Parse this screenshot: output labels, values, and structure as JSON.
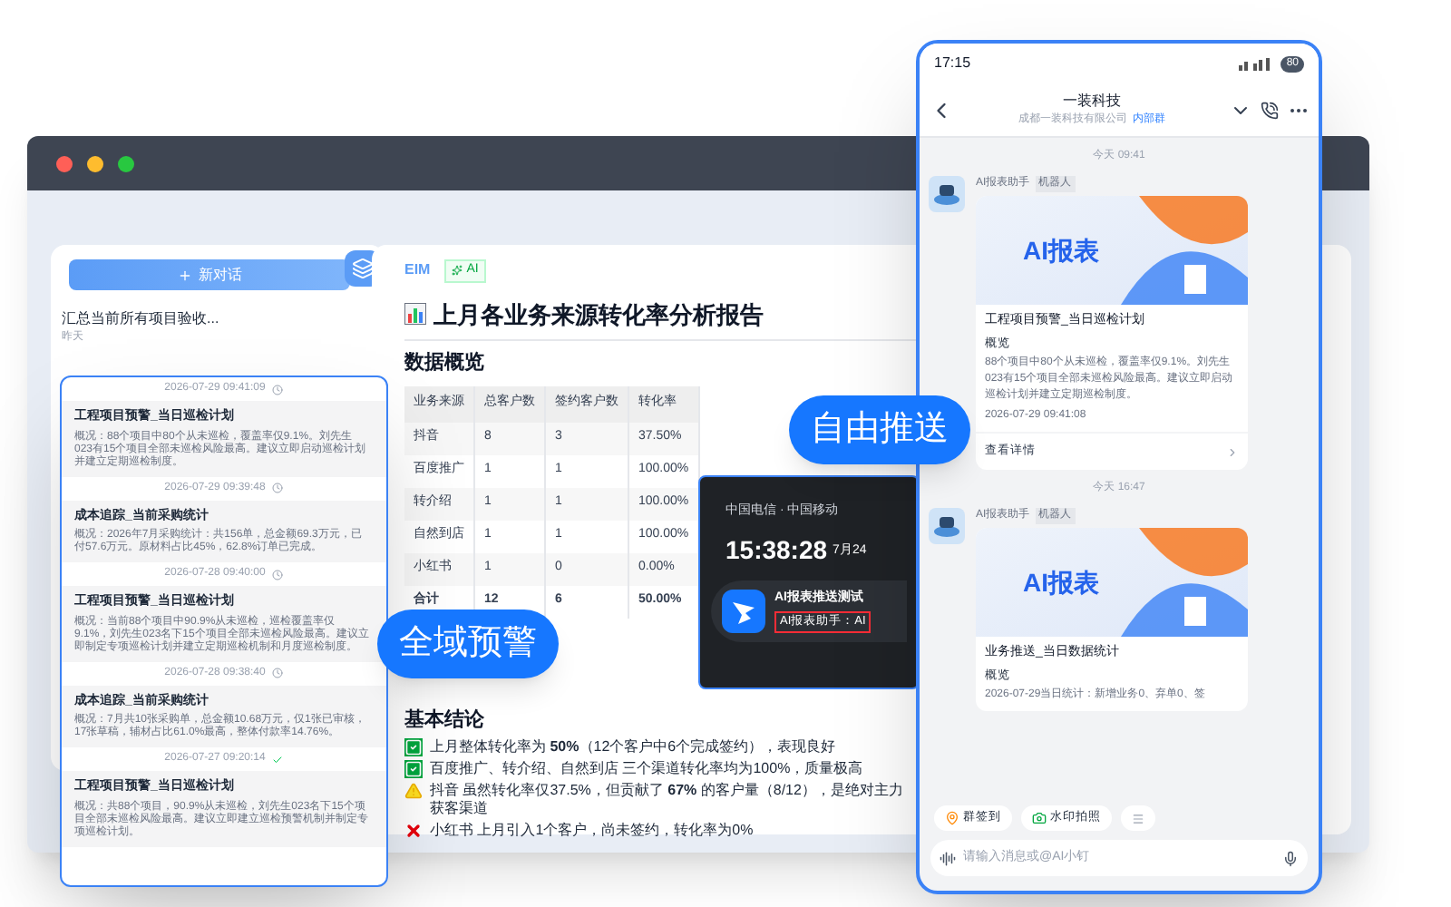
{
  "browser": {
    "sidebar": {
      "new_chat_button": "新对话",
      "history": [
        {
          "title": "汇总当前所有项目验收...",
          "time": "昨天"
        }
      ]
    },
    "report": {
      "brand": "EIM",
      "badge": "AI",
      "title": "上月各业务来源转化率分析报告",
      "section": "数据概览",
      "table": {
        "columns": [
          "业务来源",
          "总客户数",
          "签约客户数",
          "转化率"
        ],
        "rows": [
          {
            "cells": [
              "抖音",
              "8",
              "3",
              "37.50%"
            ],
            "total": false
          },
          {
            "cells": [
              "百度推广",
              "1",
              "1",
              "100.00%"
            ],
            "total": false
          },
          {
            "cells": [
              "转介绍",
              "1",
              "1",
              "100.00%"
            ],
            "total": false
          },
          {
            "cells": [
              "自然到店",
              "1",
              "1",
              "100.00%"
            ],
            "total": false
          },
          {
            "cells": [
              "小红书",
              "1",
              "0",
              "0.00%"
            ],
            "total": false
          },
          {
            "cells": [
              "合计",
              "12",
              "6",
              "50.00%"
            ],
            "total": true
          }
        ]
      },
      "conclusion_title": "基本结论",
      "conclusions": [
        {
          "kind": "good",
          "text": "上月整体转化率为 **50%**（12个客户中6个完成签约），表现良好"
        },
        {
          "kind": "good",
          "text": "百度推广、转介绍、自然到店 三个渠道转化率均为100%，质量极高"
        },
        {
          "kind": "warn",
          "text": "抖音 虽然转化率仅37.5%，但贡献了 **67%** 的客户量（8/12），是绝对主力获客渠道"
        },
        {
          "kind": "bad",
          "text": "小红书 上月引入1个客户，尚未签约，转化率为0%"
        }
      ]
    }
  },
  "alerts": [
    {
      "time": "2026-07-29 09:41:09",
      "done": false,
      "title": "工程项目预警_当日巡检计划",
      "summary": "概况：88个项目中80个从未巡检，覆盖率仅9.1%。刘先生023有15个项目全部未巡检风险最高。建议立即启动巡检计划并建立定期巡检制度。"
    },
    {
      "time": "2026-07-29 09:39:48",
      "done": false,
      "title": "成本追踪_当前采购统计",
      "summary": "概况：2026年7月采购统计：共156单，总金额69.3万元，已付57.6万元。原材料占比45%，62.8%订单已完成。"
    },
    {
      "time": "2026-07-28 09:40:00",
      "done": false,
      "title": "工程项目预警_当日巡检计划",
      "summary": "概况：当前88个项目中90.9%从未巡检，巡检覆盖率仅9.1%，刘先生023名下15个项目全部未巡检风险最高。建议立即制定专项巡检计划并建立定期巡检机制和月度巡检制度。"
    },
    {
      "time": "2026-07-28 09:38:40",
      "done": false,
      "title": "成本追踪_当前采购统计",
      "summary": "概况：7月共10张采购单，总金额10.68万元，仅1张已审核，17张草稿，辅材占比61.0%最高，整体付款率14.76%。"
    },
    {
      "time": "2026-07-27 09:20:14",
      "done": true,
      "title": "工程项目预警_当日巡检计划",
      "summary": "概况：共88个项目，90.9%从未巡检，刘先生023名下15个项目全部未巡检风险最高。建议立即建立巡检预警机制并制定专项巡检计划。"
    }
  ],
  "callouts": [
    {
      "text": "全域预警"
    },
    {
      "text": "自由推送"
    }
  ],
  "lock_notification": {
    "carrier": "中国电信 · 中国移动",
    "time": "15:38:28",
    "date": "7月24",
    "title": "AI报表推送测试",
    "message": "AI报表助手：AI"
  },
  "phone": {
    "status_time": "17:15",
    "battery": "80",
    "chat_title": "一装科技",
    "company": "成都一装科技有限公司",
    "group_tag": "内部群",
    "messages": [
      {
        "time": "今天 09:41",
        "sender": "AI报表助手",
        "sender_tag": "机器人",
        "banner": "AI报表",
        "title": "工程项目预警_当日巡检计划",
        "section": "概览",
        "body": "88个项目中80个从未巡检，覆盖率仅9.1%。刘先生023有15个项目全部未巡检风险最高。建议立即启动巡检计划并建立定期巡检制度。",
        "stamp": "2026-07-29 09:41:08",
        "link": "查看详情"
      },
      {
        "time": "今天 16:47",
        "sender": "AI报表助手",
        "sender_tag": "机器人",
        "banner": "AI报表",
        "title": "业务推送_当日数据统计",
        "section": "概览",
        "body": "2026-07-29当日统计：新增业务0、弃单0、签"
      }
    ],
    "quick_actions": [
      {
        "kind": "checkin",
        "label": "群签到"
      },
      {
        "kind": "camera",
        "label": "水印拍照"
      },
      {
        "kind": "more"
      }
    ],
    "input_placeholder": "请输入消息或@AI小钉"
  }
}
